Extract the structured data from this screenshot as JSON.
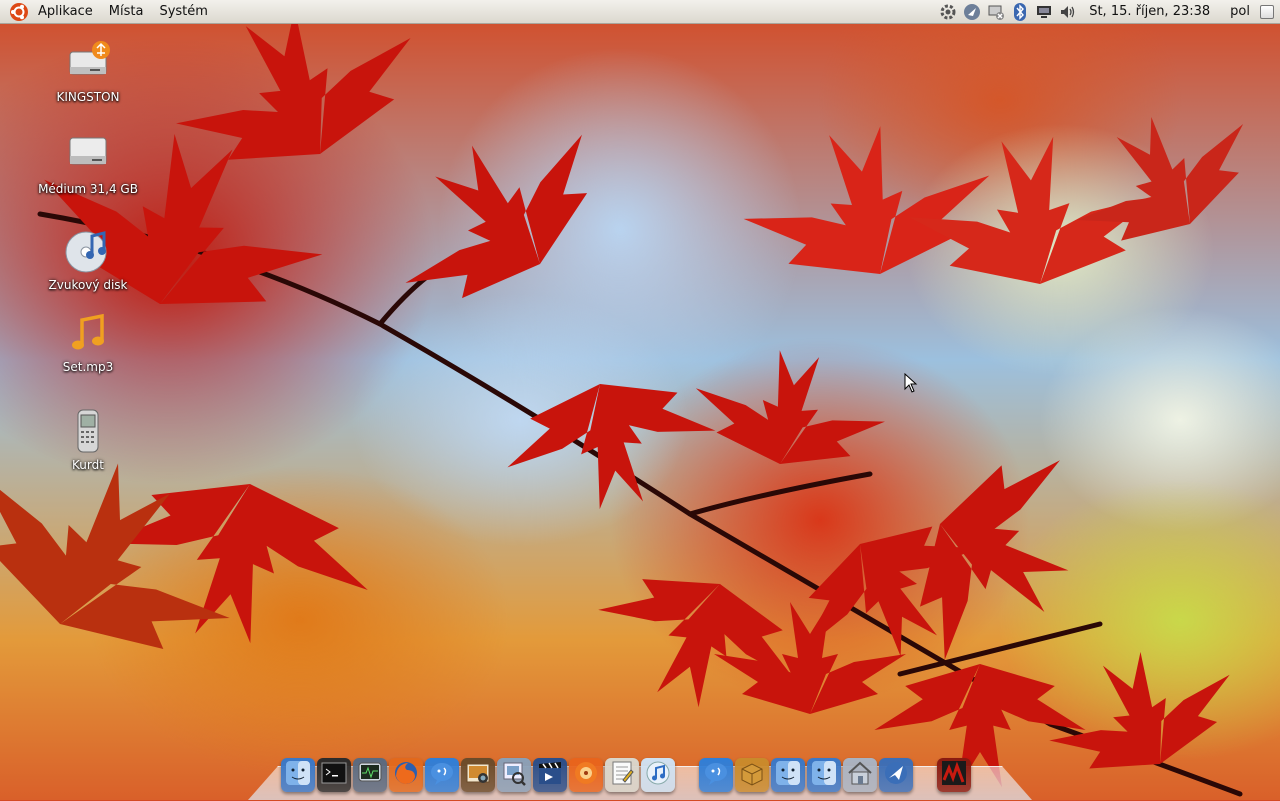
{
  "top_panel": {
    "menus": [
      "Aplikace",
      "Místa",
      "Systém"
    ],
    "clock": "St, 15. říjen, 23:38",
    "keyboard_layout": "pol",
    "tray_icons": [
      "system-settings-icon",
      "network-manager-icon",
      "network-disconnected-icon",
      "bluetooth-icon",
      "display-icon",
      "volume-icon"
    ]
  },
  "desktop": {
    "icons": [
      {
        "label": "KINGSTON",
        "icon": "usb-drive-icon"
      },
      {
        "label": "Médium 31,4 GB",
        "icon": "hard-drive-icon"
      },
      {
        "label": "Zvukový disk",
        "icon": "audio-cd-icon"
      },
      {
        "label": "Set.mp3",
        "icon": "music-file-icon"
      },
      {
        "label": "Kurdt",
        "icon": "phone-icon"
      }
    ]
  },
  "dock": {
    "items": [
      {
        "icon": "finder-icon",
        "color": "#3a78c8"
      },
      {
        "icon": "terminal-icon",
        "color": "#2b2b2b"
      },
      {
        "icon": "system-monitor-icon",
        "color": "#5a6a80"
      },
      {
        "icon": "firefox-icon",
        "color": "#e2691c"
      },
      {
        "icon": "chat-icon",
        "color": "#2f7ed8"
      },
      {
        "icon": "photo-icon",
        "color": "#6b4b2a"
      },
      {
        "icon": "preview-icon",
        "color": "#8aa0b8"
      },
      {
        "icon": "movie-icon",
        "color": "#2a4e8a"
      },
      {
        "icon": "rhythmbox-icon",
        "color": "#e8641c"
      },
      {
        "icon": "text-editor-icon",
        "color": "#d9d6cc"
      },
      {
        "icon": "itunes-icon",
        "color": "#cfe2f3"
      },
      {
        "icon": "messenger-icon",
        "color": "#2f7ed8"
      },
      {
        "icon": "package-icon",
        "color": "#c98a2b"
      },
      {
        "icon": "finder-icon",
        "color": "#3a78c8"
      },
      {
        "icon": "finder-icon",
        "color": "#3a78c8"
      },
      {
        "icon": "home-folder-icon",
        "color": "#a9b3c2"
      },
      {
        "icon": "mail-icon",
        "color": "#3a6eb8"
      },
      {
        "icon": "wallpaper-thumbnail-icon",
        "color": "#8a1a10"
      }
    ]
  }
}
